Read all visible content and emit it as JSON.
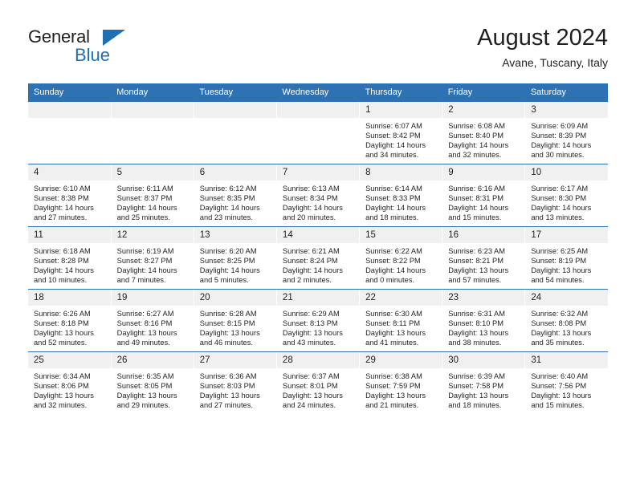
{
  "brand": {
    "name_part1": "General",
    "name_part2": "Blue",
    "triangle_icon": "blue-triangle-icon",
    "accent_color": "#1F6FB5"
  },
  "header": {
    "title": "August 2024",
    "subtitle": "Avane, Tuscany, Italy"
  },
  "theme": {
    "header_blue": "#2E72B3",
    "daynum_bg": "#f0f0f0",
    "text": "#231f20"
  },
  "calendar": {
    "weekday_headers": [
      "Sunday",
      "Monday",
      "Tuesday",
      "Wednesday",
      "Thursday",
      "Friday",
      "Saturday"
    ],
    "labels": {
      "sunrise": "Sunrise:",
      "sunset": "Sunset:",
      "daylight": "Daylight:"
    },
    "weeks": [
      [
        {
          "day": "",
          "empty": true,
          "sunrise": "",
          "sunset": "",
          "daylight_line1": "",
          "daylight_line2": ""
        },
        {
          "day": "",
          "empty": true,
          "sunrise": "",
          "sunset": "",
          "daylight_line1": "",
          "daylight_line2": ""
        },
        {
          "day": "",
          "empty": true,
          "sunrise": "",
          "sunset": "",
          "daylight_line1": "",
          "daylight_line2": ""
        },
        {
          "day": "",
          "empty": true,
          "sunrise": "",
          "sunset": "",
          "daylight_line1": "",
          "daylight_line2": ""
        },
        {
          "day": "1",
          "empty": false,
          "sunrise": "Sunrise: 6:07 AM",
          "sunset": "Sunset: 8:42 PM",
          "daylight_line1": "Daylight: 14 hours",
          "daylight_line2": "and 34 minutes."
        },
        {
          "day": "2",
          "empty": false,
          "sunrise": "Sunrise: 6:08 AM",
          "sunset": "Sunset: 8:40 PM",
          "daylight_line1": "Daylight: 14 hours",
          "daylight_line2": "and 32 minutes."
        },
        {
          "day": "3",
          "empty": false,
          "sunrise": "Sunrise: 6:09 AM",
          "sunset": "Sunset: 8:39 PM",
          "daylight_line1": "Daylight: 14 hours",
          "daylight_line2": "and 30 minutes."
        }
      ],
      [
        {
          "day": "4",
          "empty": false,
          "sunrise": "Sunrise: 6:10 AM",
          "sunset": "Sunset: 8:38 PM",
          "daylight_line1": "Daylight: 14 hours",
          "daylight_line2": "and 27 minutes."
        },
        {
          "day": "5",
          "empty": false,
          "sunrise": "Sunrise: 6:11 AM",
          "sunset": "Sunset: 8:37 PM",
          "daylight_line1": "Daylight: 14 hours",
          "daylight_line2": "and 25 minutes."
        },
        {
          "day": "6",
          "empty": false,
          "sunrise": "Sunrise: 6:12 AM",
          "sunset": "Sunset: 8:35 PM",
          "daylight_line1": "Daylight: 14 hours",
          "daylight_line2": "and 23 minutes."
        },
        {
          "day": "7",
          "empty": false,
          "sunrise": "Sunrise: 6:13 AM",
          "sunset": "Sunset: 8:34 PM",
          "daylight_line1": "Daylight: 14 hours",
          "daylight_line2": "and 20 minutes."
        },
        {
          "day": "8",
          "empty": false,
          "sunrise": "Sunrise: 6:14 AM",
          "sunset": "Sunset: 8:33 PM",
          "daylight_line1": "Daylight: 14 hours",
          "daylight_line2": "and 18 minutes."
        },
        {
          "day": "9",
          "empty": false,
          "sunrise": "Sunrise: 6:16 AM",
          "sunset": "Sunset: 8:31 PM",
          "daylight_line1": "Daylight: 14 hours",
          "daylight_line2": "and 15 minutes."
        },
        {
          "day": "10",
          "empty": false,
          "sunrise": "Sunrise: 6:17 AM",
          "sunset": "Sunset: 8:30 PM",
          "daylight_line1": "Daylight: 14 hours",
          "daylight_line2": "and 13 minutes."
        }
      ],
      [
        {
          "day": "11",
          "empty": false,
          "sunrise": "Sunrise: 6:18 AM",
          "sunset": "Sunset: 8:28 PM",
          "daylight_line1": "Daylight: 14 hours",
          "daylight_line2": "and 10 minutes."
        },
        {
          "day": "12",
          "empty": false,
          "sunrise": "Sunrise: 6:19 AM",
          "sunset": "Sunset: 8:27 PM",
          "daylight_line1": "Daylight: 14 hours",
          "daylight_line2": "and 7 minutes."
        },
        {
          "day": "13",
          "empty": false,
          "sunrise": "Sunrise: 6:20 AM",
          "sunset": "Sunset: 8:25 PM",
          "daylight_line1": "Daylight: 14 hours",
          "daylight_line2": "and 5 minutes."
        },
        {
          "day": "14",
          "empty": false,
          "sunrise": "Sunrise: 6:21 AM",
          "sunset": "Sunset: 8:24 PM",
          "daylight_line1": "Daylight: 14 hours",
          "daylight_line2": "and 2 minutes."
        },
        {
          "day": "15",
          "empty": false,
          "sunrise": "Sunrise: 6:22 AM",
          "sunset": "Sunset: 8:22 PM",
          "daylight_line1": "Daylight: 14 hours",
          "daylight_line2": "and 0 minutes."
        },
        {
          "day": "16",
          "empty": false,
          "sunrise": "Sunrise: 6:23 AM",
          "sunset": "Sunset: 8:21 PM",
          "daylight_line1": "Daylight: 13 hours",
          "daylight_line2": "and 57 minutes."
        },
        {
          "day": "17",
          "empty": false,
          "sunrise": "Sunrise: 6:25 AM",
          "sunset": "Sunset: 8:19 PM",
          "daylight_line1": "Daylight: 13 hours",
          "daylight_line2": "and 54 minutes."
        }
      ],
      [
        {
          "day": "18",
          "empty": false,
          "sunrise": "Sunrise: 6:26 AM",
          "sunset": "Sunset: 8:18 PM",
          "daylight_line1": "Daylight: 13 hours",
          "daylight_line2": "and 52 minutes."
        },
        {
          "day": "19",
          "empty": false,
          "sunrise": "Sunrise: 6:27 AM",
          "sunset": "Sunset: 8:16 PM",
          "daylight_line1": "Daylight: 13 hours",
          "daylight_line2": "and 49 minutes."
        },
        {
          "day": "20",
          "empty": false,
          "sunrise": "Sunrise: 6:28 AM",
          "sunset": "Sunset: 8:15 PM",
          "daylight_line1": "Daylight: 13 hours",
          "daylight_line2": "and 46 minutes."
        },
        {
          "day": "21",
          "empty": false,
          "sunrise": "Sunrise: 6:29 AM",
          "sunset": "Sunset: 8:13 PM",
          "daylight_line1": "Daylight: 13 hours",
          "daylight_line2": "and 43 minutes."
        },
        {
          "day": "22",
          "empty": false,
          "sunrise": "Sunrise: 6:30 AM",
          "sunset": "Sunset: 8:11 PM",
          "daylight_line1": "Daylight: 13 hours",
          "daylight_line2": "and 41 minutes."
        },
        {
          "day": "23",
          "empty": false,
          "sunrise": "Sunrise: 6:31 AM",
          "sunset": "Sunset: 8:10 PM",
          "daylight_line1": "Daylight: 13 hours",
          "daylight_line2": "and 38 minutes."
        },
        {
          "day": "24",
          "empty": false,
          "sunrise": "Sunrise: 6:32 AM",
          "sunset": "Sunset: 8:08 PM",
          "daylight_line1": "Daylight: 13 hours",
          "daylight_line2": "and 35 minutes."
        }
      ],
      [
        {
          "day": "25",
          "empty": false,
          "sunrise": "Sunrise: 6:34 AM",
          "sunset": "Sunset: 8:06 PM",
          "daylight_line1": "Daylight: 13 hours",
          "daylight_line2": "and 32 minutes."
        },
        {
          "day": "26",
          "empty": false,
          "sunrise": "Sunrise: 6:35 AM",
          "sunset": "Sunset: 8:05 PM",
          "daylight_line1": "Daylight: 13 hours",
          "daylight_line2": "and 29 minutes."
        },
        {
          "day": "27",
          "empty": false,
          "sunrise": "Sunrise: 6:36 AM",
          "sunset": "Sunset: 8:03 PM",
          "daylight_line1": "Daylight: 13 hours",
          "daylight_line2": "and 27 minutes."
        },
        {
          "day": "28",
          "empty": false,
          "sunrise": "Sunrise: 6:37 AM",
          "sunset": "Sunset: 8:01 PM",
          "daylight_line1": "Daylight: 13 hours",
          "daylight_line2": "and 24 minutes."
        },
        {
          "day": "29",
          "empty": false,
          "sunrise": "Sunrise: 6:38 AM",
          "sunset": "Sunset: 7:59 PM",
          "daylight_line1": "Daylight: 13 hours",
          "daylight_line2": "and 21 minutes."
        },
        {
          "day": "30",
          "empty": false,
          "sunrise": "Sunrise: 6:39 AM",
          "sunset": "Sunset: 7:58 PM",
          "daylight_line1": "Daylight: 13 hours",
          "daylight_line2": "and 18 minutes."
        },
        {
          "day": "31",
          "empty": false,
          "sunrise": "Sunrise: 6:40 AM",
          "sunset": "Sunset: 7:56 PM",
          "daylight_line1": "Daylight: 13 hours",
          "daylight_line2": "and 15 minutes."
        }
      ]
    ]
  }
}
